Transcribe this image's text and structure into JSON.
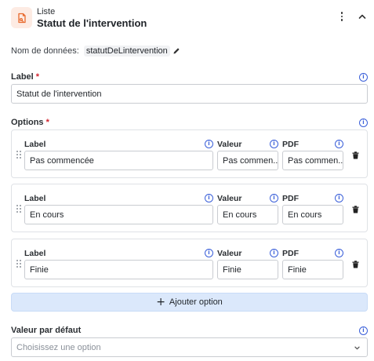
{
  "header": {
    "type_name": "Liste",
    "title": "Statut de l'intervention"
  },
  "data_name": {
    "label": "Nom de données:",
    "value": "statutDeLintervention"
  },
  "label_section": {
    "label": "Label",
    "required_mark": "*",
    "value": "Statut de l'intervention"
  },
  "options_section": {
    "label": "Options",
    "required_mark": "*",
    "col_label": "Label",
    "col_value": "Valeur",
    "col_pdf": "PDF",
    "items": [
      {
        "label": "Pas commencée",
        "value": "Pas commen...",
        "pdf": "Pas commen..."
      },
      {
        "label": "En cours",
        "value": "En cours",
        "pdf": "En cours"
      },
      {
        "label": "Finie",
        "value": "Finie",
        "pdf": "Finie"
      }
    ],
    "add_button": "Ajouter option"
  },
  "default_section": {
    "label": "Valeur par défaut",
    "placeholder": "Choisissez une option"
  },
  "icons": {
    "type": "list-doc-icon",
    "menu": "kebab-menu-icon",
    "collapse": "chevron-up-icon",
    "edit": "pencil-icon",
    "info": "info-icon",
    "drag": "drag-handle-icon",
    "delete": "trash-icon",
    "add": "plus-icon",
    "select": "chevron-down-icon"
  },
  "colors": {
    "accent": "#3a5fd9",
    "required": "#d1242f",
    "type_icon": "#e8692c",
    "add_button_bg": "#dbe8fb"
  }
}
